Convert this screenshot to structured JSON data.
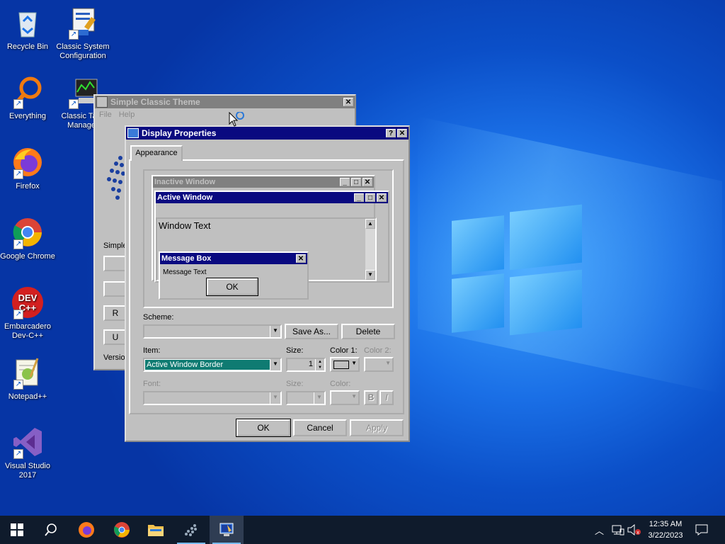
{
  "desktop_icons": [
    {
      "label": "Recycle Bin",
      "icon": "recycle-bin-icon"
    },
    {
      "label": "Classic System Configuration",
      "icon": "system-config-icon"
    },
    {
      "label": "Everything",
      "icon": "everything-search-icon"
    },
    {
      "label": "Classic Task Manager",
      "icon": "task-manager-icon"
    },
    {
      "label": "Firefox",
      "icon": "firefox-icon"
    },
    {
      "label": "Google Chrome",
      "icon": "chrome-icon"
    },
    {
      "label": "Embarcadero Dev-C++",
      "icon": "devcpp-icon"
    },
    {
      "label": "Notepad++",
      "icon": "notepadpp-icon"
    },
    {
      "label": "Visual Studio 2017",
      "icon": "visual-studio-icon"
    }
  ],
  "simple_classic_theme": {
    "title": "Simple Classic Theme",
    "menu_file": "File",
    "menu_help": "Help",
    "simple_label": "Simple",
    "version_label": "Versio",
    "btn_r": "R",
    "btn_u": "U"
  },
  "display_properties": {
    "title": "Display Properties",
    "help_btn": "?",
    "close_btn": "✕",
    "tab": "Appearance",
    "preview": {
      "inactive_title": "Inactive Window",
      "active_title": "Active Window",
      "window_text": "Window Text",
      "msgbox_title": "Message Box",
      "msgbox_text": "Message Text",
      "msgbox_ok": "OK"
    },
    "scheme_label": "Scheme:",
    "scheme_value": "",
    "save_as": "Save As...",
    "delete": "Delete",
    "item_label": "Item:",
    "item_value": "Active Window Border",
    "size_label": "Size:",
    "size_value": "1",
    "color1_label": "Color 1:",
    "color2_label": "Color 2:",
    "font_label": "Font:",
    "font_size_label": "Size:",
    "font_color_label": "Color:",
    "bold": "B",
    "italic": "I",
    "ok": "OK",
    "cancel": "Cancel",
    "apply": "Apply"
  },
  "taskbar": {
    "time": "12:35 AM",
    "date": "3/22/2023"
  },
  "colors": {
    "active_title": "#0a0a80",
    "inactive_title": "#808080",
    "highlight": "#0f7b72",
    "window_face": "#c0c0c0"
  }
}
